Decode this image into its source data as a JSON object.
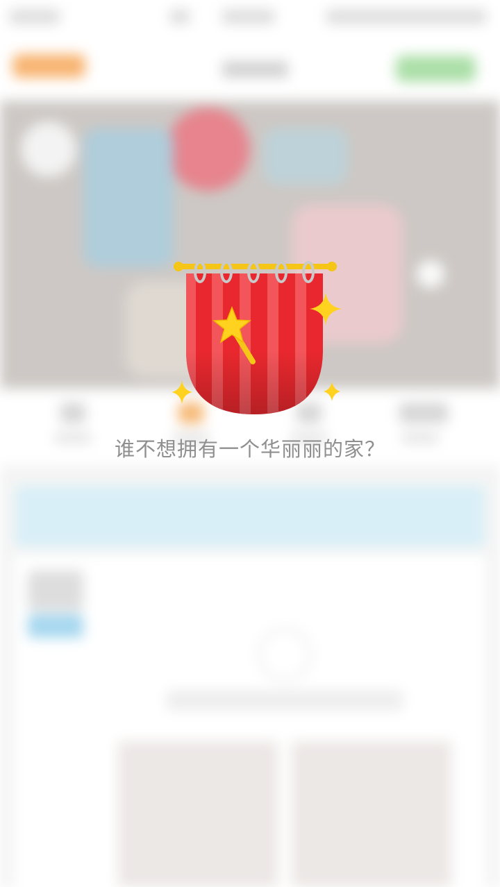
{
  "overlay": {
    "slogan": "谁不想拥有一个华丽丽的家？",
    "illustration": "curtain-with-magic-wand",
    "colors": {
      "curtain_red": "#e8282e",
      "curtain_stripe": "#f2555a",
      "rod_gold": "#f5c518",
      "star_yellow": "#ffd21f",
      "slogan_gray": "#8f8f8f"
    }
  }
}
